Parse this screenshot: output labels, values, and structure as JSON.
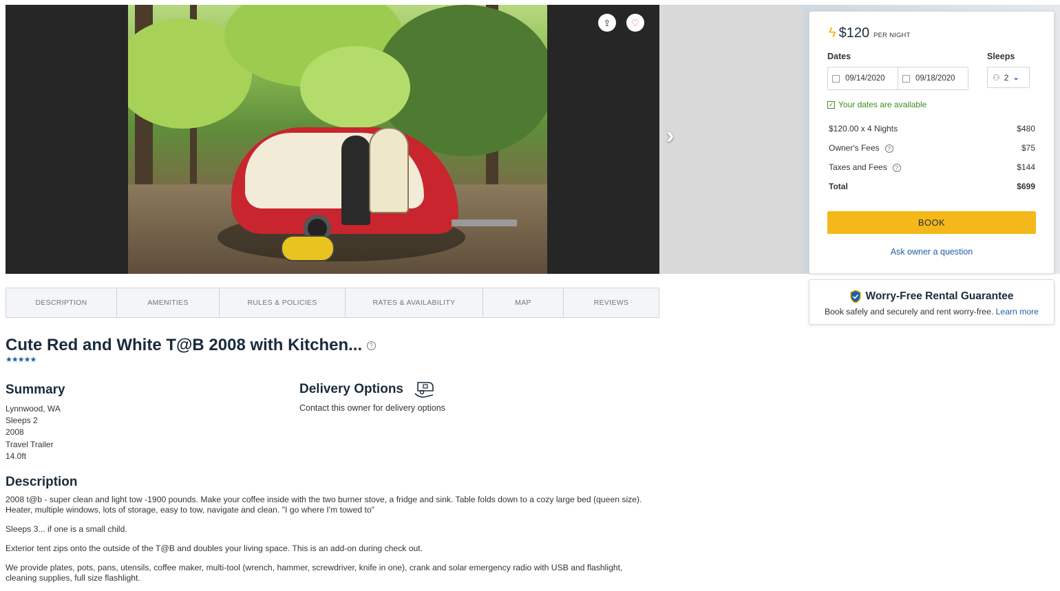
{
  "gallery": {
    "share_icon": "share-icon",
    "favorite_icon": "heart-icon",
    "next_icon": "chevron-right-icon"
  },
  "tabs": [
    {
      "label": "DESCRIPTION"
    },
    {
      "label": "AMENITIES"
    },
    {
      "label": "RULES & POLICIES"
    },
    {
      "label": "RATES & AVAILABILITY"
    },
    {
      "label": "MAP"
    },
    {
      "label": "REVIEWS"
    }
  ],
  "listing": {
    "title": "Cute Red and White T@B 2008 with Kitchen...",
    "help_glyph": "?",
    "rating": 5,
    "stars": "★★★★★"
  },
  "summary": {
    "heading": "Summary",
    "lines": [
      "Lynnwood, WA",
      "Sleeps 2",
      "2008",
      "Travel Trailer",
      "14.0ft"
    ]
  },
  "delivery": {
    "heading": "Delivery Options",
    "text": "Contact this owner for delivery options",
    "icon": "delivery-trailer-icon"
  },
  "description": {
    "heading": "Description",
    "paragraphs": [
      "2008 t@b - super clean and light tow -1900 pounds. Make your coffee inside with the two burner stove, a fridge and sink. Table folds down to a cozy large bed (queen size). Heater, multiple windows, lots of storage, easy to tow, navigate and clean. \"I go where I'm towed to\"",
      "Sleeps 3... if one is a small child.",
      "Exterior tent zips onto the outside of the T@B and doubles your living space. This is an add-on during check out.",
      "We provide plates, pots, pans, utensils, coffee maker, multi-tool (wrench, hammer, screwdriver, knife in one), crank and solar emergency radio with USB and flashlight, cleaning supplies, full size flashlight."
    ]
  },
  "booking": {
    "price": "$120",
    "per_night": "PER NIGHT",
    "dates_label": "Dates",
    "sleeps_label": "Sleeps",
    "start_date": "09/14/2020",
    "end_date": "09/18/2020",
    "sleeps_value": "2",
    "availability": "Your dates are available",
    "fees": [
      {
        "label": "$120.00 x 4 Nights",
        "value": "$480",
        "help": false
      },
      {
        "label": "Owner's Fees",
        "value": "$75",
        "help": true
      },
      {
        "label": "Taxes and Fees",
        "value": "$144",
        "help": true
      },
      {
        "label": "Total",
        "value": "$699",
        "help": false
      }
    ],
    "book_label": "BOOK",
    "ask_label": "Ask owner a question",
    "accent_color": "#f4b81a",
    "link_color": "#1f5fa8",
    "available_color": "#3a8a1f"
  },
  "guarantee": {
    "title": "Worry-Free Rental Guarantee",
    "text": "Book safely and securely and rent worry-free.",
    "link": "Learn more"
  }
}
